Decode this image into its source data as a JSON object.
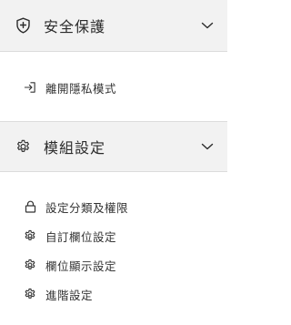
{
  "sections": {
    "security": {
      "title": "安全保護",
      "icon": "shield-icon",
      "items": [
        {
          "label": "離開隱私模式",
          "icon": "sign-in-icon"
        }
      ]
    },
    "module": {
      "title": "模組設定",
      "icon": "gear-icon",
      "items": [
        {
          "label": "設定分類及權限",
          "icon": "lock-icon"
        },
        {
          "label": "自訂欄位設定",
          "icon": "gear-icon"
        },
        {
          "label": "欄位顯示設定",
          "icon": "gear-icon"
        },
        {
          "label": "進階設定",
          "icon": "gear-icon"
        }
      ]
    }
  },
  "colors": {
    "header_bg": "#f2f2f2",
    "text": "#2b2b2b",
    "border": "#dcdcdc"
  }
}
